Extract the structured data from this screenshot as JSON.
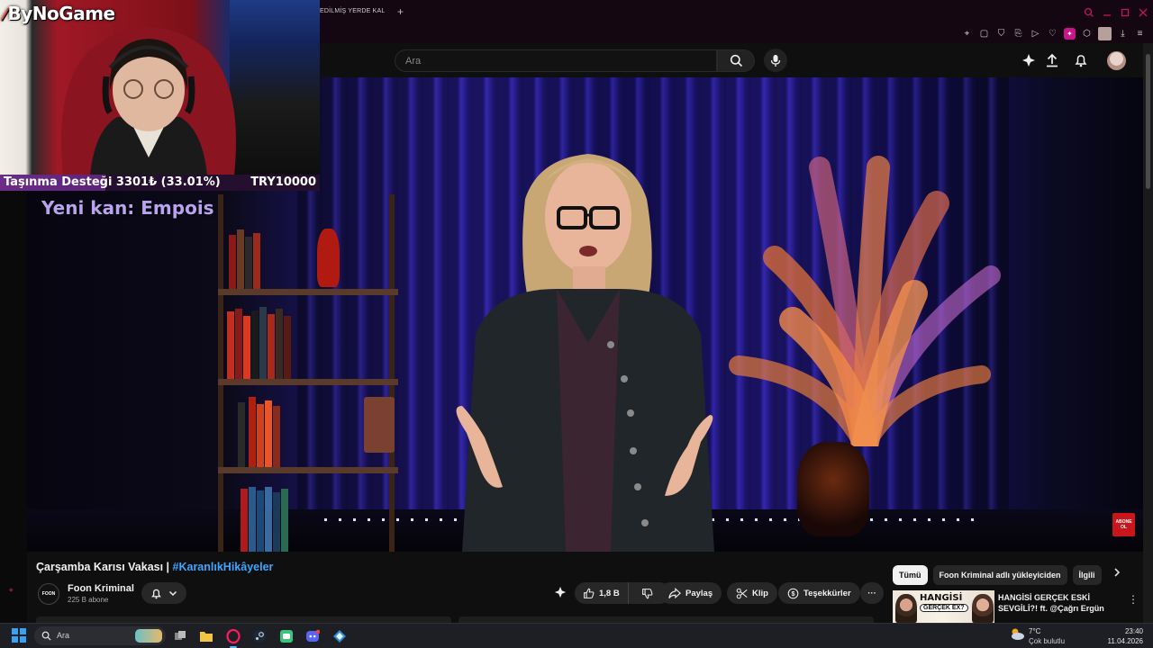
{
  "browser": {
    "tab_title": "EDİLMİŞ YERDE KAL",
    "new_tab": "+"
  },
  "youtube": {
    "search_placeholder": "Ara"
  },
  "overlay": {
    "brand": "ByNoGame",
    "donation_label": "Taşınma Desteği 3301₺ (33.01%)",
    "donation_goal": "TRY10000",
    "donation_progress": 0.3301,
    "new_subscriber": "Yeni kan: Empois"
  },
  "video": {
    "title_main": "Çarşamba Karısı Vakası | ",
    "title_tag": "#KaranlıkHikâyeler",
    "abone_badge": "ABONE OL"
  },
  "channel": {
    "logo_text": "FOON",
    "name": "Foon Kriminal",
    "subscribers": "225 B abone"
  },
  "actions": {
    "likes": "1,8 B",
    "share": "Paylaş",
    "clip": "Klip",
    "thanks": "Teşekkürler",
    "more": "···"
  },
  "chips": [
    "Tümü",
    "Foon Kriminal adlı yükleyiciden",
    "İlgili"
  ],
  "recommendation": {
    "thumb_text": "HANGİSİ",
    "thumb_sub": "GERÇEK EX?",
    "title": "HANGİSİ GERÇEK ESKİ SEVGİLİ?! ft. @Çağrı Ergün"
  },
  "taskbar": {
    "search_placeholder": "Ara",
    "temperature": "7°C",
    "condition": "Çok bulutlu",
    "time": "23:40",
    "date": "11.04.2026"
  },
  "colors": {
    "accent_link": "#3ea6ff",
    "donation_fill": "#6b2d88",
    "new_sub_text": "#b9a3ef",
    "brand_red": "#e8473c"
  }
}
